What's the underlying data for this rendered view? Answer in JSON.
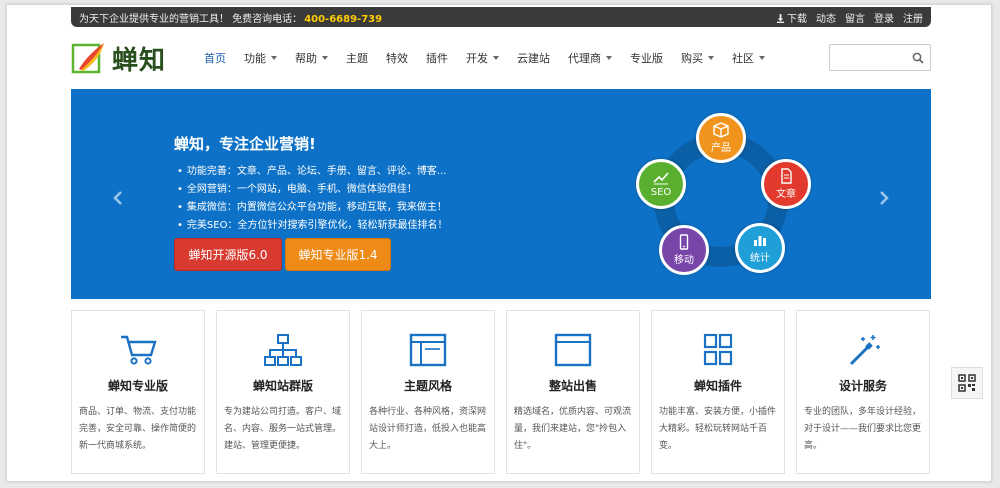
{
  "topbar": {
    "slogan": "为天下企业提供专业的营销工具！  免费咨询电话：",
    "phone": "400-6689-739",
    "links": [
      "下载",
      "动态",
      "留言",
      "登录",
      "注册"
    ]
  },
  "logo": {
    "text": "蝉知"
  },
  "nav": {
    "items": [
      {
        "label": "首页",
        "dropdown": false
      },
      {
        "label": "功能",
        "dropdown": true
      },
      {
        "label": "帮助",
        "dropdown": true
      },
      {
        "label": "主题",
        "dropdown": false
      },
      {
        "label": "特效",
        "dropdown": false
      },
      {
        "label": "插件",
        "dropdown": false
      },
      {
        "label": "开发",
        "dropdown": true
      },
      {
        "label": "云建站",
        "dropdown": false
      },
      {
        "label": "代理商",
        "dropdown": true
      },
      {
        "label": "专业版",
        "dropdown": false
      },
      {
        "label": "购买",
        "dropdown": true
      },
      {
        "label": "社区",
        "dropdown": true
      }
    ],
    "search_placeholder": ""
  },
  "banner": {
    "headline": "蝉知，专注企业营销!",
    "features": [
      "功能完善：文章、产品、论坛、手册、留言、评论、博客...",
      "全网营销：一个网站，电脑、手机、微信体验俱佳！",
      "集成微信：内置微信公众平台功能，移动互联，我来做主！",
      "完美SEO：全方位针对搜索引擎优化，轻松斩获最佳排名！"
    ],
    "btn_primary": "蝉知开源版6.0",
    "btn_secondary": "蝉知专业版1.4",
    "circle_labels": {
      "product": "产品",
      "article": "文章",
      "stats": "统计",
      "mobile": "移动",
      "seo": "SEO"
    },
    "colors": {
      "background": "#0d72c7",
      "ring": "#0b5fa6"
    }
  },
  "cards": [
    {
      "title": "蝉知专业版",
      "icon": "cart-icon",
      "desc": "商品、订单、物流、支付功能完善，安全可靠、操作简便的新一代商城系统。"
    },
    {
      "title": "蝉知站群版",
      "icon": "sitemap-icon",
      "desc": "专为建站公司打造。客户、域名、内容、服务一站式管理。建站、管理更便捷。"
    },
    {
      "title": "主题风格",
      "icon": "browser-window-icon",
      "desc": "各种行业、各种风格，资深网站设计师打造，低投入也能高大上。"
    },
    {
      "title": "整站出售",
      "icon": "browser-window-icon",
      "desc": "精选域名，优质内容、可观流量，我们来建站，您\"拎包入住\"。"
    },
    {
      "title": "蝉知插件",
      "icon": "grid-icon",
      "desc": "功能丰富、安装方便，小插件大精彩。轻松玩转网站千百变。"
    },
    {
      "title": "设计服务",
      "icon": "magic-wand-icon",
      "desc": "专业的团队，多年设计经验，对于设计——我们要求比您更高。"
    }
  ]
}
